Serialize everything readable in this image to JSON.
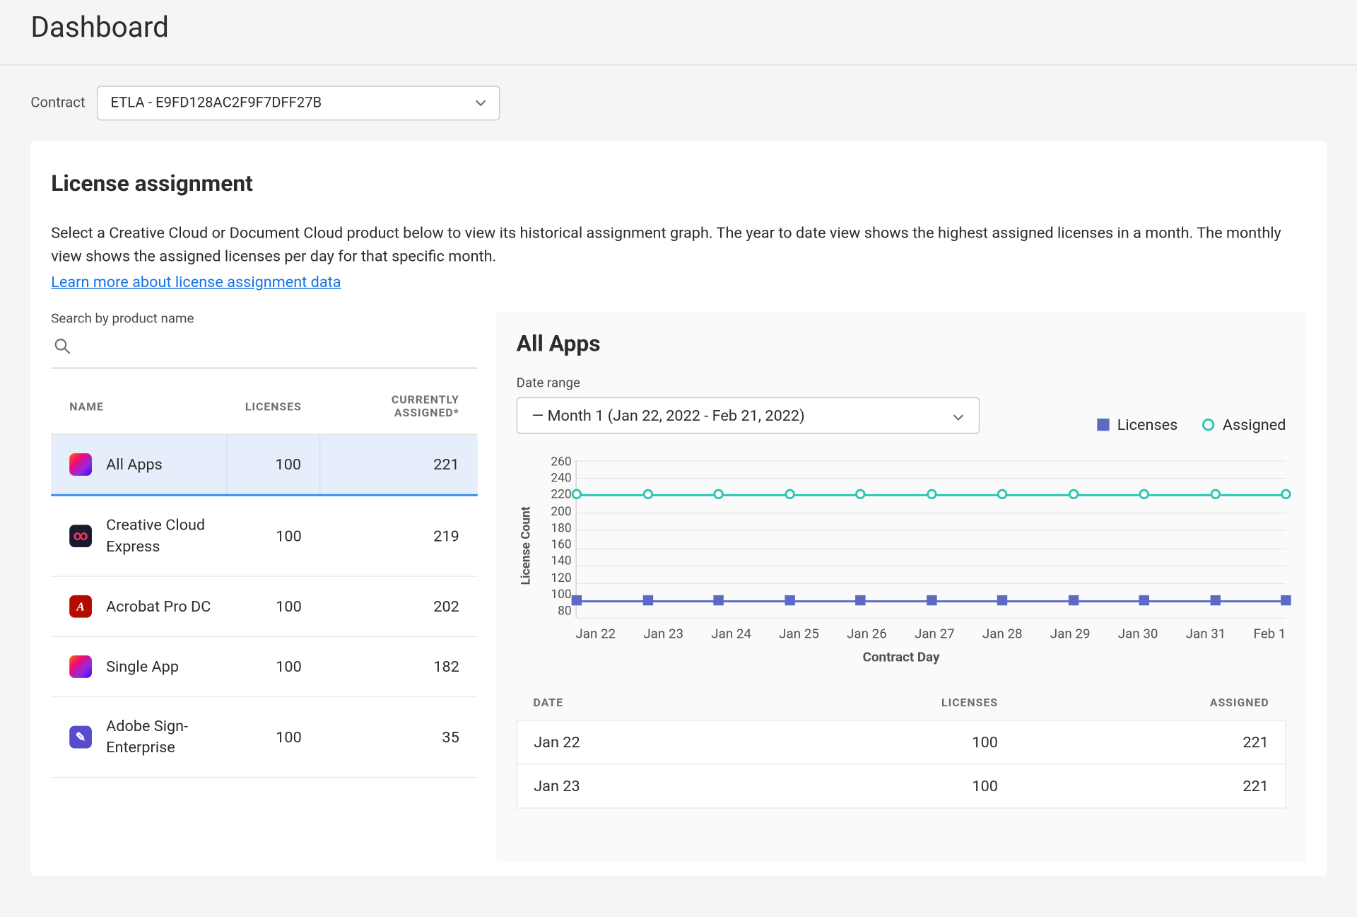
{
  "page": {
    "title": "Dashboard"
  },
  "contract": {
    "label": "Contract",
    "value": "ETLA - E9FD128AC2F9F7DFF27B"
  },
  "section": {
    "title": "License assignment",
    "description": "Select a Creative Cloud or Document Cloud product below to view its historical assignment graph. The year to date view shows the highest assigned licenses in a month. The monthly view shows the assigned licenses per day for that specific month.",
    "learn_link": "Learn more about license assignment data"
  },
  "search": {
    "label": "Search by product name",
    "placeholder": ""
  },
  "product_table": {
    "headers": {
      "name": "NAME",
      "licenses": "LICENSES",
      "assigned": "CURRENTLY ASSIGNED*"
    },
    "rows": [
      {
        "icon": "ic-allapps",
        "name": "All Apps",
        "licenses": 100,
        "assigned": 221,
        "selected": true
      },
      {
        "icon": "ic-ccexpress",
        "name": "Creative Cloud Express",
        "licenses": 100,
        "assigned": 219,
        "selected": false
      },
      {
        "icon": "ic-acrobat",
        "name": "Acrobat Pro DC",
        "licenses": 100,
        "assigned": 202,
        "selected": false
      },
      {
        "icon": "ic-singleapp",
        "name": "Single App",
        "licenses": 100,
        "assigned": 182,
        "selected": false
      },
      {
        "icon": "ic-sign",
        "name": "Adobe Sign-Enterprise",
        "licenses": 100,
        "assigned": 35,
        "selected": false
      }
    ]
  },
  "detail": {
    "title": "All Apps",
    "date_range": {
      "label": "Date range",
      "value": "— Month 1 (Jan 22, 2022 - Feb 21, 2022)"
    },
    "legend": {
      "licenses": "Licenses",
      "assigned": "Assigned"
    }
  },
  "chart_data": {
    "type": "line",
    "title": "All Apps",
    "xlabel": "Contract Day",
    "ylabel": "License Count",
    "ylim": [
      80,
      260
    ],
    "yticks": [
      260,
      240,
      220,
      200,
      180,
      160,
      140,
      120,
      100,
      80
    ],
    "categories": [
      "Jan 22",
      "Jan 23",
      "Jan 24",
      "Jan 25",
      "Jan 26",
      "Jan 27",
      "Jan 28",
      "Jan 29",
      "Jan 30",
      "Jan 31",
      "Feb 1"
    ],
    "series": [
      {
        "name": "Licenses",
        "color": "#5c6ac4",
        "marker": "square",
        "values": [
          100,
          100,
          100,
          100,
          100,
          100,
          100,
          100,
          100,
          100,
          100
        ]
      },
      {
        "name": "Assigned",
        "color": "#2ec4b6",
        "marker": "circle",
        "values": [
          221,
          221,
          221,
          221,
          221,
          221,
          221,
          221,
          221,
          221,
          221
        ]
      }
    ]
  },
  "data_table": {
    "headers": {
      "date": "DATE",
      "licenses": "LICENSES",
      "assigned": "ASSIGNED"
    },
    "rows": [
      {
        "date": "Jan 22",
        "licenses": 100,
        "assigned": 221
      },
      {
        "date": "Jan 23",
        "licenses": 100,
        "assigned": 221
      }
    ]
  }
}
